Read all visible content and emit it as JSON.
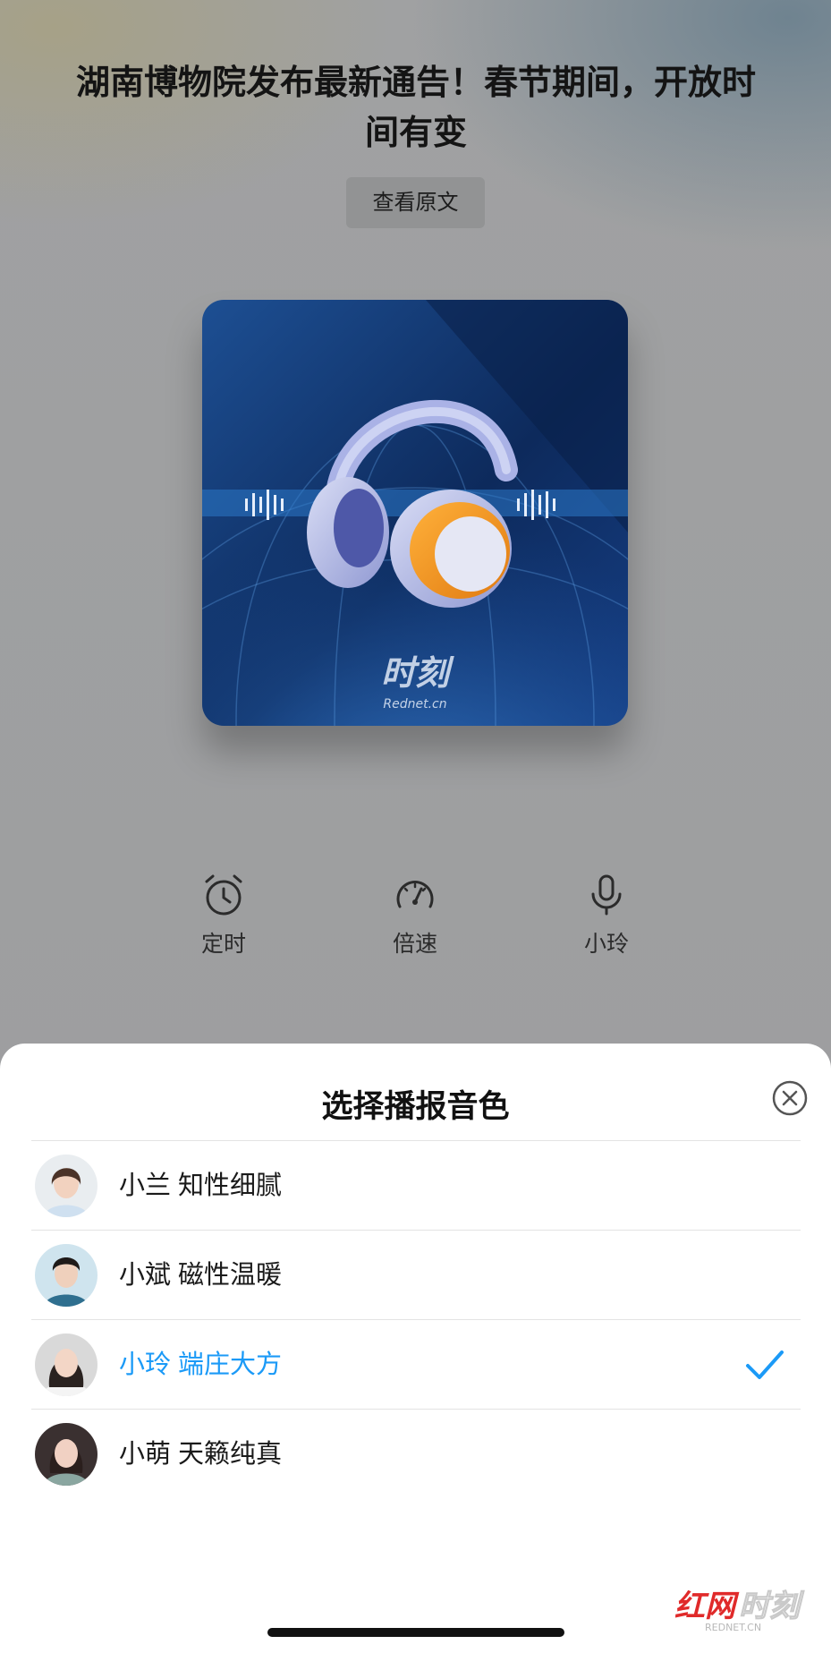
{
  "article": {
    "title": "湖南博物院发布最新通告！春节期间，开放时间有变",
    "view_original": "查看原文"
  },
  "cover": {
    "logo_text": "时刻",
    "logo_sub": "Rednet.cn"
  },
  "controls": [
    {
      "label": "定时",
      "icon": "alarm-clock-icon"
    },
    {
      "label": "倍速",
      "icon": "speedometer-icon"
    },
    {
      "label": "小玲",
      "icon": "microphone-icon"
    }
  ],
  "sheet": {
    "title": "选择播报音色",
    "voices": [
      {
        "label": "小兰 知性细腻",
        "selected": false
      },
      {
        "label": "小斌 磁性温暖",
        "selected": false
      },
      {
        "label": "小玲 端庄大方",
        "selected": true
      },
      {
        "label": "小萌 天籁纯真",
        "selected": false
      }
    ]
  },
  "watermark": {
    "text": "红网时刻",
    "sub": "REDNET.CN"
  },
  "colors": {
    "accent": "#1b9af7",
    "cover_dark": "#0d2a5c",
    "cover_light": "#1c5aa8"
  }
}
